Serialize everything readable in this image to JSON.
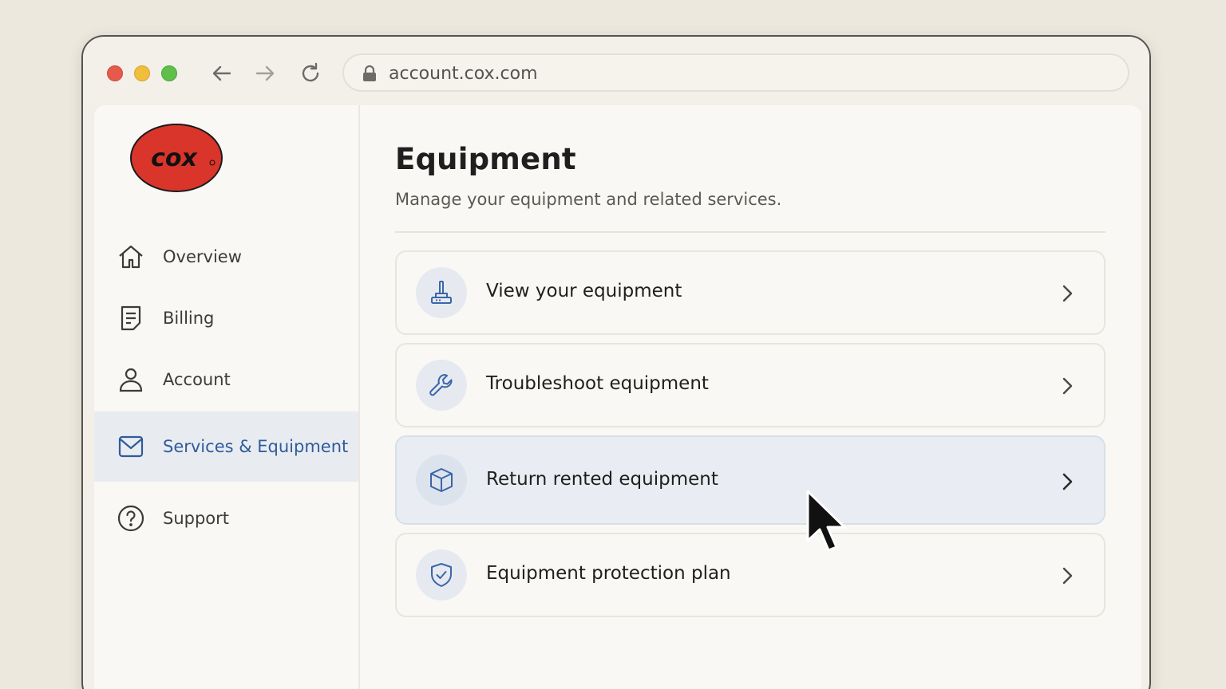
{
  "browser": {
    "url": "account.cox.com"
  },
  "brand": {
    "logo_text": "cox",
    "logo_color": "#d9352b"
  },
  "sidebar": {
    "items": [
      {
        "label": "Overview",
        "icon": "home-icon"
      },
      {
        "label": "Billing",
        "icon": "document-icon"
      },
      {
        "label": "Account",
        "icon": "user-icon"
      },
      {
        "label": "Services & Equipment",
        "icon": "envelope-icon",
        "active": true
      },
      {
        "label": "Support",
        "icon": "help-circle-icon"
      }
    ]
  },
  "main": {
    "title": "Equipment",
    "subtitle": "Manage your equipment and related services.",
    "cards": [
      {
        "label": "View your equipment",
        "icon": "router-icon"
      },
      {
        "label": "Troubleshoot equipment",
        "icon": "wrench-icon"
      },
      {
        "label": "Return rented equipment",
        "icon": "box-icon",
        "hovered": true
      },
      {
        "label": "Equipment protection plan",
        "icon": "shield-check-icon"
      }
    ]
  },
  "colors": {
    "accent": "#2f5b9b",
    "icon_blue": "#3a66a8",
    "active_bg": "#e8ecf1"
  }
}
